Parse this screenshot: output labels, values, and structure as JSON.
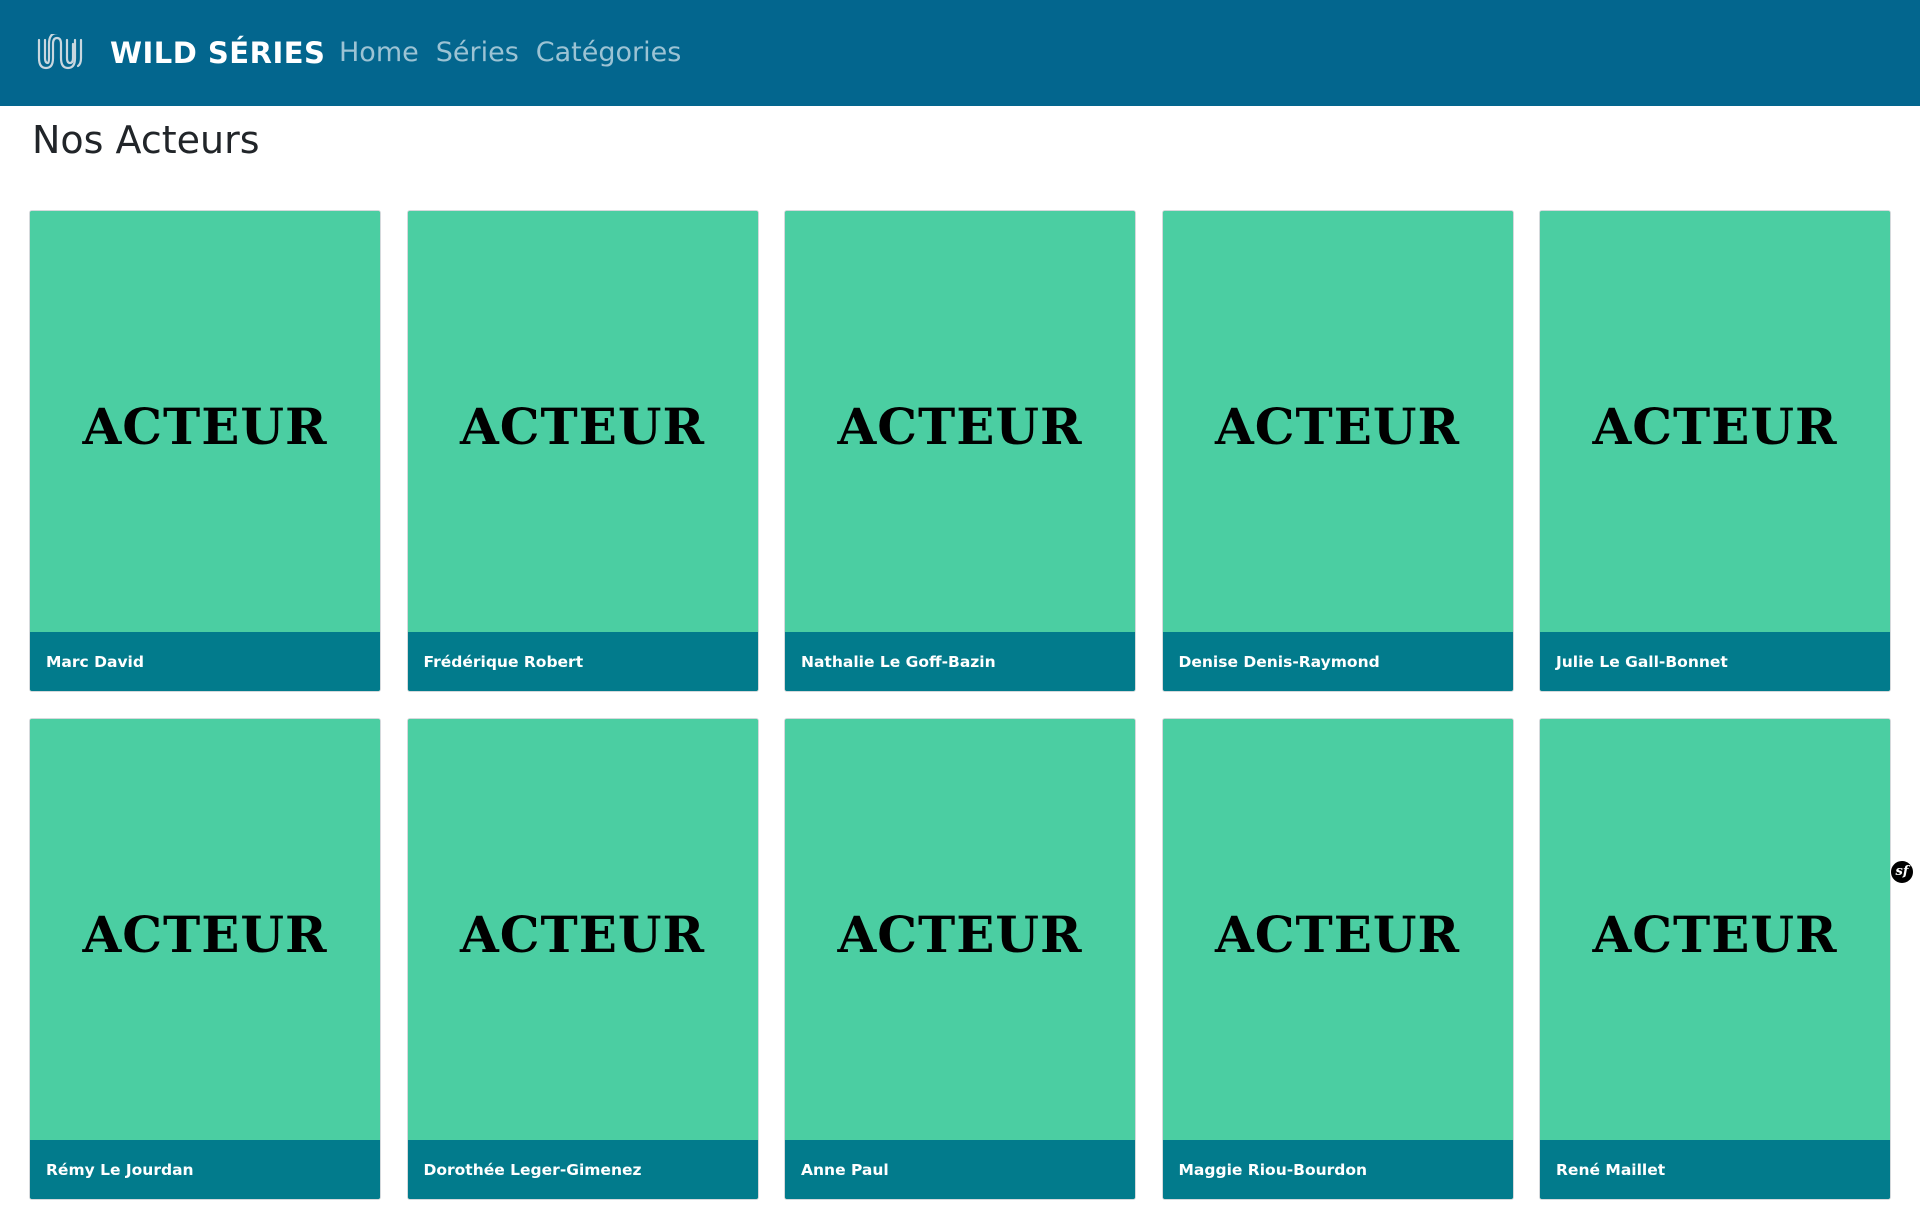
{
  "navbar": {
    "logo_icon": "wild-wave-logo-icon",
    "brand": "WILD SÉRIES",
    "links": [
      {
        "label": "Home"
      },
      {
        "label": "Séries"
      },
      {
        "label": "Catégories"
      }
    ],
    "background_color": "#03668e",
    "link_color": "#9cc3d4"
  },
  "page": {
    "title": "Nos Acteurs"
  },
  "actors": [
    {
      "image_text": "ACTEUR",
      "name": "Marc David"
    },
    {
      "image_text": "ACTEUR",
      "name": "Frédérique Robert"
    },
    {
      "image_text": "ACTEUR",
      "name": "Nathalie Le Goff-Bazin"
    },
    {
      "image_text": "ACTEUR",
      "name": "Denise Denis-Raymond"
    },
    {
      "image_text": "ACTEUR",
      "name": "Julie Le Gall-Bonnet"
    },
    {
      "image_text": "ACTEUR",
      "name": "Rémy Le Jourdan"
    },
    {
      "image_text": "ACTEUR",
      "name": "Dorothée Leger-Gimenez"
    },
    {
      "image_text": "ACTEUR",
      "name": "Anne Paul"
    },
    {
      "image_text": "ACTEUR",
      "name": "Maggie Riou-Bourdon"
    },
    {
      "image_text": "ACTEUR",
      "name": "René Maillet"
    }
  ],
  "colors": {
    "card_image": "#4bcea2",
    "card_footer": "#027b8c"
  },
  "debug_toolbar": {
    "icon": "symfony-icon",
    "glyph": "sf"
  }
}
